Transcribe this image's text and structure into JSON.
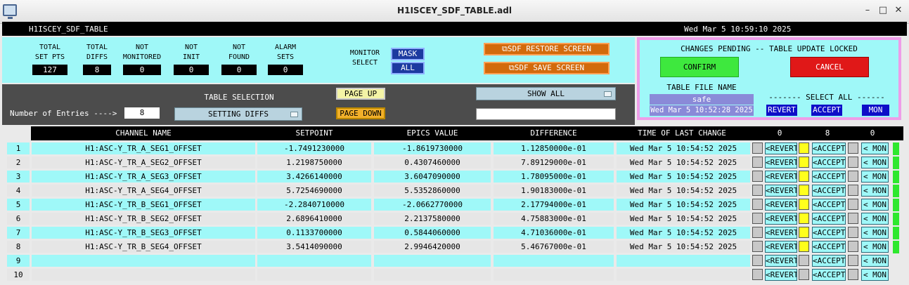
{
  "window": {
    "title": "H1ISCEY_SDF_TABLE.adl",
    "min": "–",
    "max": "□",
    "close": "✕"
  },
  "header": {
    "name": "H1ISCEY_SDF_TABLE",
    "datetime": "Wed Mar  5 10:59:10 2025"
  },
  "stats": [
    {
      "label1": "TOTAL",
      "label2": "SET PTS",
      "value": "127"
    },
    {
      "label1": "TOTAL",
      "label2": "DIFFS",
      "value": "8"
    },
    {
      "label1": "NOT",
      "label2": "MONITORED",
      "value": "0"
    },
    {
      "label1": "NOT",
      "label2": "INIT",
      "value": "0"
    },
    {
      "label1": "NOT",
      "label2": "FOUND",
      "value": "0"
    },
    {
      "label1": "ALARM",
      "label2": "SETS",
      "value": "0"
    }
  ],
  "monitor": {
    "label1": "MONITOR",
    "label2": "SELECT",
    "mask": "MASK",
    "all": "ALL"
  },
  "restore_button": "⧉SDF RESTORE SCREEN",
  "save_button": "⧉SDF SAVE SCREEN",
  "pending": {
    "title": "CHANGES PENDING -- TABLE UPDATE LOCKED",
    "confirm": "CONFIRM",
    "cancel": "CANCEL",
    "file_label": "TABLE FILE NAME",
    "file_name": "safe",
    "file_time": "Wed Mar  5 10:52:28 2025",
    "select_all": "------- SELECT ALL -------",
    "revert": "REVERT",
    "accept": "ACCEPT",
    "mon": "MON"
  },
  "controls": {
    "entries_label": "Number of Entries ---->",
    "entries": "8",
    "table_selection_label": "TABLE SELECTION",
    "table_selection": "SETTING DIFFS",
    "page_up": "PAGE UP",
    "page_down": "PAGE DOWN",
    "show": "SHOW ALL"
  },
  "columns": {
    "channel": "CHANNEL NAME",
    "setpoint": "SETPOINT",
    "epics": "EPICS VALUE",
    "difference": "DIFFERENCE",
    "time": "TIME OF LAST CHANGE",
    "revert_count": "0",
    "accept_count": "8",
    "mon_count": "0"
  },
  "row_buttons": {
    "revert": "<REVERT",
    "accept": "<ACCEPT",
    "mon": "< MON"
  },
  "rows": [
    {
      "n": "1",
      "channel": "H1:ASC-Y_TR_A_SEG1_OFFSET",
      "setpoint": "-1.7491230000",
      "epics": "-1.8619730000",
      "diff": "1.12850000e-01",
      "time": "Wed Mar  5 10:54:52 2025",
      "accept": true,
      "ok": true
    },
    {
      "n": "2",
      "channel": "H1:ASC-Y_TR_A_SEG2_OFFSET",
      "setpoint": "1.2198750000",
      "epics": "0.4307460000",
      "diff": "7.89129000e-01",
      "time": "Wed Mar  5 10:54:52 2025",
      "accept": true,
      "ok": true
    },
    {
      "n": "3",
      "channel": "H1:ASC-Y_TR_A_SEG3_OFFSET",
      "setpoint": "3.4266140000",
      "epics": "3.6047090000",
      "diff": "1.78095000e-01",
      "time": "Wed Mar  5 10:54:52 2025",
      "accept": true,
      "ok": true
    },
    {
      "n": "4",
      "channel": "H1:ASC-Y_TR_A_SEG4_OFFSET",
      "setpoint": "5.7254690000",
      "epics": "5.5352860000",
      "diff": "1.90183000e-01",
      "time": "Wed Mar  5 10:54:52 2025",
      "accept": true,
      "ok": true
    },
    {
      "n": "5",
      "channel": "H1:ASC-Y_TR_B_SEG1_OFFSET",
      "setpoint": "-2.2840710000",
      "epics": "-2.0662770000",
      "diff": "2.17794000e-01",
      "time": "Wed Mar  5 10:54:52 2025",
      "accept": true,
      "ok": true
    },
    {
      "n": "6",
      "channel": "H1:ASC-Y_TR_B_SEG2_OFFSET",
      "setpoint": "2.6896410000",
      "epics": "2.2137580000",
      "diff": "4.75883000e-01",
      "time": "Wed Mar  5 10:54:52 2025",
      "accept": true,
      "ok": true
    },
    {
      "n": "7",
      "channel": "H1:ASC-Y_TR_B_SEG3_OFFSET",
      "setpoint": "0.1133700000",
      "epics": "0.5844060000",
      "diff": "4.71036000e-01",
      "time": "Wed Mar  5 10:54:52 2025",
      "accept": true,
      "ok": true
    },
    {
      "n": "8",
      "channel": "H1:ASC-Y_TR_B_SEG4_OFFSET",
      "setpoint": "3.5414090000",
      "epics": "2.9946420000",
      "diff": "5.46767000e-01",
      "time": "Wed Mar  5 10:54:52 2025",
      "accept": true,
      "ok": true
    },
    {
      "n": "9",
      "channel": "",
      "setpoint": "",
      "epics": "",
      "diff": "",
      "time": "",
      "accept": false,
      "ok": false
    },
    {
      "n": "10",
      "channel": "",
      "setpoint": "",
      "epics": "",
      "diff": "",
      "time": "",
      "accept": false,
      "ok": false
    }
  ],
  "colors": {
    "cyan": "#9ff8f8",
    "row_alt": "#e6e6e6",
    "accept_on": "#ffff1c",
    "indicator": "#2ee82e",
    "confirm": "#3ee83e",
    "cancel": "#e01818"
  }
}
